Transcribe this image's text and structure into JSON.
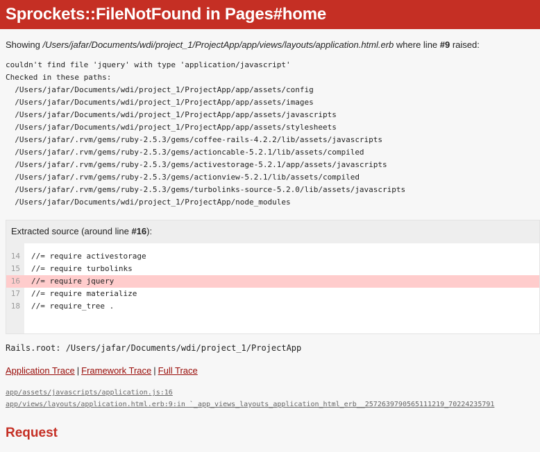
{
  "header": {
    "title": "Sprockets::FileNotFound in Pages#home"
  },
  "showing": {
    "prefix": "Showing ",
    "path": "/Users/jafar/Documents/wdi/project_1/ProjectApp/app/views/layouts/application.html.erb",
    "middle": " where line ",
    "line": "#9",
    "suffix": " raised:"
  },
  "error_message": "couldn't find file 'jquery' with type 'application/javascript'\nChecked in these paths:\n  /Users/jafar/Documents/wdi/project_1/ProjectApp/app/assets/config\n  /Users/jafar/Documents/wdi/project_1/ProjectApp/app/assets/images\n  /Users/jafar/Documents/wdi/project_1/ProjectApp/app/assets/javascripts\n  /Users/jafar/Documents/wdi/project_1/ProjectApp/app/assets/stylesheets\n  /Users/jafar/.rvm/gems/ruby-2.5.3/gems/coffee-rails-4.2.2/lib/assets/javascripts\n  /Users/jafar/.rvm/gems/ruby-2.5.3/gems/actioncable-5.2.1/lib/assets/compiled\n  /Users/jafar/.rvm/gems/ruby-2.5.3/gems/activestorage-5.2.1/app/assets/javascripts\n  /Users/jafar/.rvm/gems/ruby-2.5.3/gems/actionview-5.2.1/lib/assets/compiled\n  /Users/jafar/.rvm/gems/ruby-2.5.3/gems/turbolinks-source-5.2.0/lib/assets/javascripts\n  /Users/jafar/Documents/wdi/project_1/ProjectApp/node_modules",
  "source": {
    "title_prefix": "Extracted source (around line ",
    "title_line": "#16",
    "title_suffix": "):",
    "lines": [
      {
        "num": "14",
        "code": "//= require activestorage"
      },
      {
        "num": "15",
        "code": "//= require turbolinks"
      },
      {
        "num": "16",
        "code": "//= require jquery"
      },
      {
        "num": "17",
        "code": "//= require materialize"
      },
      {
        "num": "18",
        "code": "//= require_tree ."
      }
    ],
    "highlight_color": "#ffcccc"
  },
  "rails_root": "Rails.root: /Users/jafar/Documents/wdi/project_1/ProjectApp",
  "trace_tabs": {
    "application": "Application Trace",
    "framework": "Framework Trace",
    "full": "Full Trace",
    "separator": "|"
  },
  "trace_lines": [
    "app/assets/javascripts/application.js:16",
    "app/views/layouts/application.html.erb:9:in `_app_views_layouts_application_html_erb__2572639790565111219_70224235791"
  ],
  "request_heading": "Request",
  "colors": {
    "header_bg": "#c52f24",
    "link": "#980905",
    "page_bg": "#f7f7f7"
  }
}
